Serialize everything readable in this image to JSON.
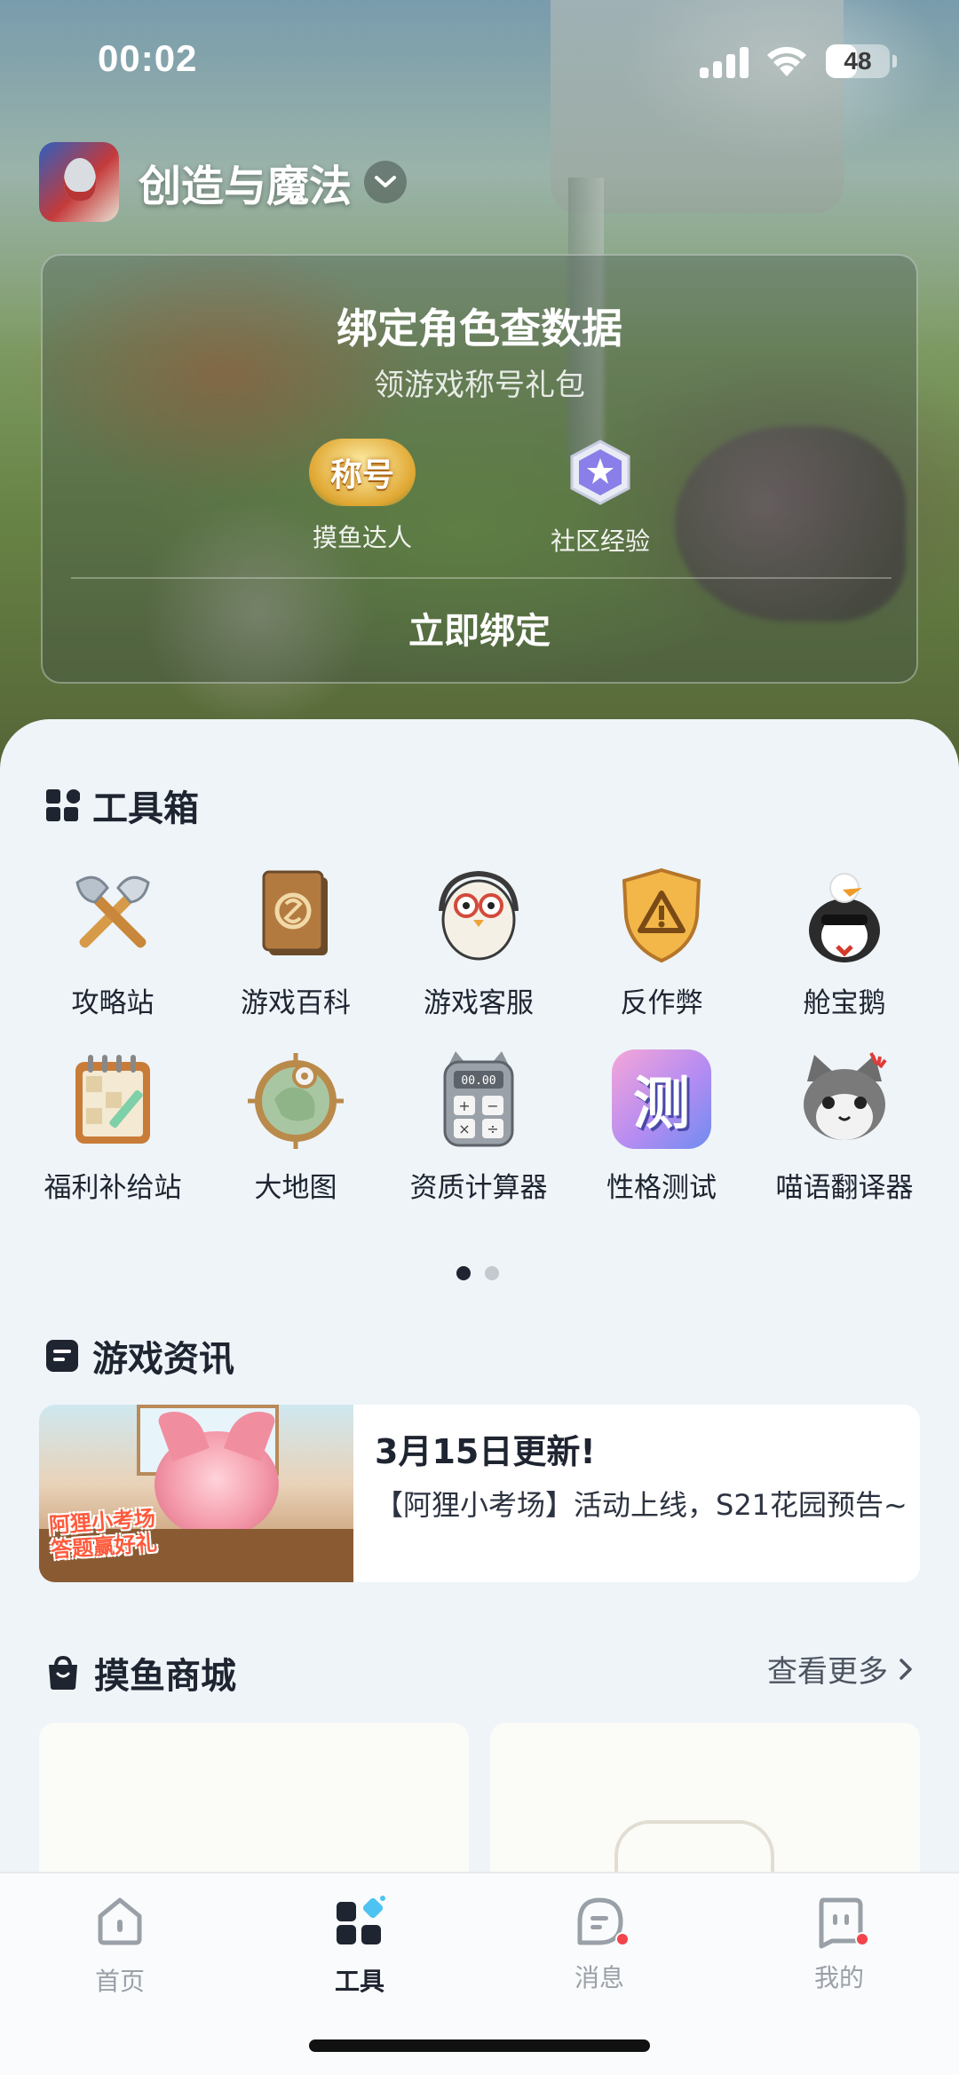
{
  "status_bar": {
    "time": "00:02",
    "battery_level": "48",
    "battery_fraction": 0.48
  },
  "game": {
    "name": "创造与魔法"
  },
  "bind_card": {
    "title": "绑定角色查数据",
    "subtitle": "领游戏称号礼包",
    "rewards": [
      {
        "badge_text": "称号",
        "label": "摸鱼达人",
        "icon": "title-badge-icon"
      },
      {
        "label": "社区经验",
        "icon": "community-exp-icon"
      }
    ],
    "button_label": "立即绑定"
  },
  "toolbox": {
    "title": "工具箱",
    "tools": [
      {
        "label": "攻略站",
        "icon": "crossed-axes-icon"
      },
      {
        "label": "游戏百科",
        "icon": "book-icon"
      },
      {
        "label": "游戏客服",
        "icon": "penguin-headset-icon"
      },
      {
        "label": "反作弊",
        "icon": "shield-warning-icon"
      },
      {
        "label": "舱宝鹅",
        "icon": "goose-mascot-icon"
      },
      {
        "label": "福利补给站",
        "icon": "notepad-icon"
      },
      {
        "label": "大地图",
        "icon": "map-icon"
      },
      {
        "label": "资质计算器",
        "icon": "calculator-icon",
        "calc_display": "00.00"
      },
      {
        "label": "性格测试",
        "icon": "test-icon",
        "icon_text": "测"
      },
      {
        "label": "喵语翻译器",
        "icon": "cat-icon"
      }
    ],
    "page_count": 2,
    "current_page": 1
  },
  "news": {
    "title": "游戏资讯",
    "items": [
      {
        "thumb_caption_line1": "阿狸小考场",
        "thumb_caption_line2": "答题赢好礼",
        "headline": "3月15日更新!",
        "description": "【阿狸小考场】活动上线，S21花园预告~"
      }
    ]
  },
  "shop": {
    "title": "摸鱼商城",
    "more_label": "查看更多"
  },
  "tabbar": {
    "tabs": [
      {
        "label": "首页",
        "icon": "home-icon",
        "active": false
      },
      {
        "label": "工具",
        "icon": "tools-icon",
        "active": true
      },
      {
        "label": "消息",
        "icon": "message-icon",
        "active": false,
        "has_badge": true
      },
      {
        "label": "我的",
        "icon": "profile-icon",
        "active": false,
        "has_badge": true
      }
    ]
  },
  "colors": {
    "accent": "#1e2430",
    "page_bg": "#eef4f8",
    "badge_red": "#f2444a",
    "inactive_tab": "#9aa0a8"
  }
}
